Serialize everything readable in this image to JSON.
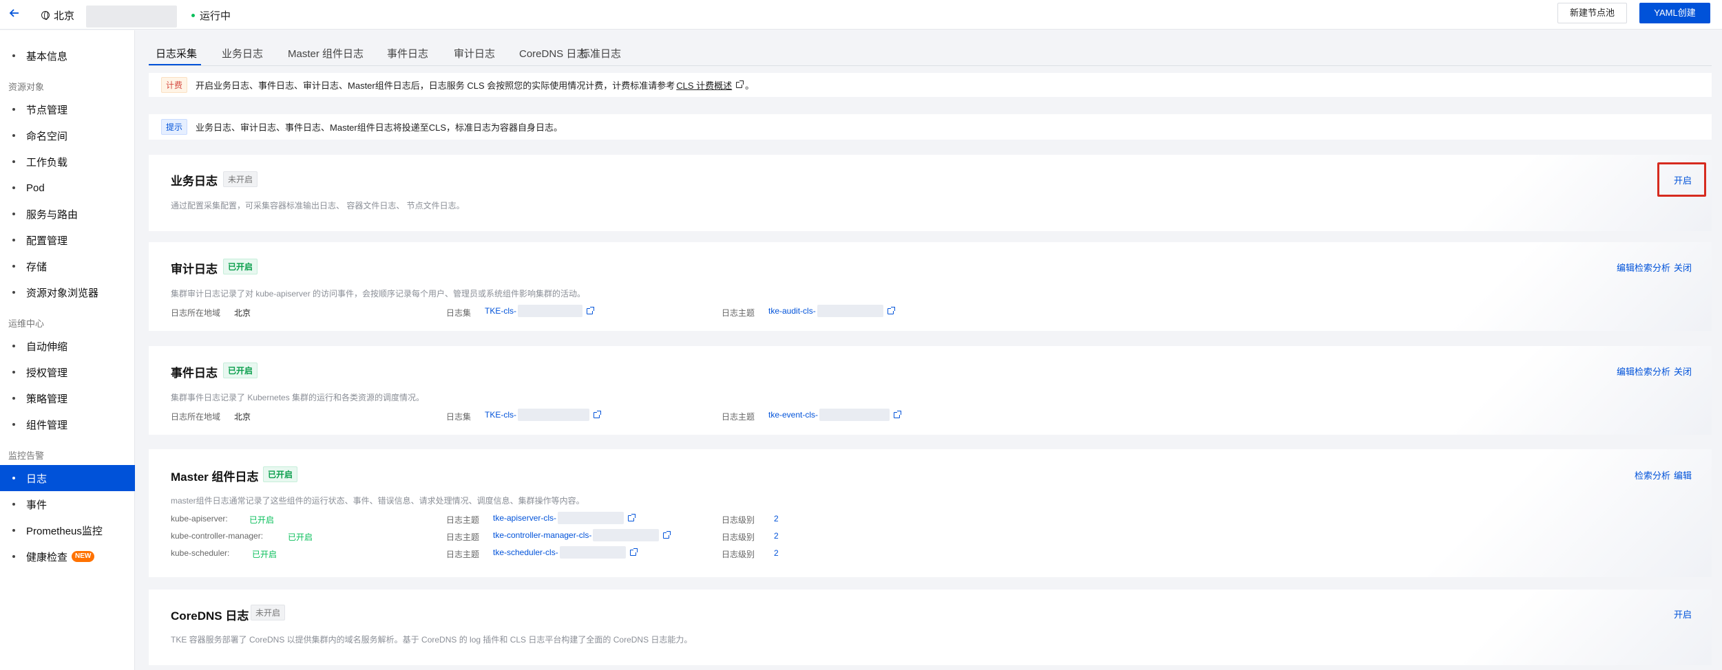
{
  "topbar": {
    "region": "北京",
    "status": "运行中",
    "new_node_pool": "新建节点池",
    "yaml_create": "YAML创建"
  },
  "sidebar": {
    "items": [
      {
        "label": "基本信息"
      },
      {
        "group": "资源对象"
      },
      {
        "label": "节点管理"
      },
      {
        "label": "命名空间"
      },
      {
        "label": "工作负载"
      },
      {
        "label": "Pod"
      },
      {
        "label": "服务与路由"
      },
      {
        "label": "配置管理"
      },
      {
        "label": "存储"
      },
      {
        "label": "资源对象浏览器"
      },
      {
        "group": "运维中心"
      },
      {
        "label": "自动伸缩"
      },
      {
        "label": "授权管理"
      },
      {
        "label": "策略管理"
      },
      {
        "label": "组件管理"
      },
      {
        "group": "监控告警"
      },
      {
        "label": "日志",
        "active": true
      },
      {
        "label": "事件"
      },
      {
        "label": "Prometheus监控"
      },
      {
        "label": "健康检查",
        "badge": "NEW"
      }
    ]
  },
  "tabs": [
    "日志采集",
    "业务日志",
    "Master 组件日志",
    "事件日志",
    "审计日志",
    "CoreDNS 日志",
    "标准日志"
  ],
  "billing_notice": {
    "tag": "计费",
    "text": "开启业务日志、事件日志、审计日志、Master组件日志后，日志服务 CLS 会按照您的实际使用情况计费，计费标准请参考",
    "link": "CLS 计费概述",
    "suffix": "。"
  },
  "tip_notice": {
    "tag": "提示",
    "text": "业务日志、审计日志、事件日志、Master组件日志将投递至CLS，标准日志为容器自身日志。"
  },
  "business_log": {
    "title": "业务日志",
    "state": "未开启",
    "desc": "通过配置采集配置，可采集容器标准输出日志、 容器文件日志、 节点文件日志。",
    "enable": "开启"
  },
  "audit_log": {
    "title": "审计日志",
    "state": "已开启",
    "desc": "集群审计日志记录了对 kube-apiserver 的访问事件，会按顺序记录每个用户、管理员或系统组件影响集群的活动。",
    "region_label": "日志所在地域",
    "region_value": "北京",
    "logset_label": "日志集",
    "logset_value": "TKE-cls-",
    "topic_label": "日志主题",
    "topic_value": "tke-audit-cls-",
    "actions": {
      "edit": "编辑",
      "search": "检索分析",
      "close": "关闭"
    }
  },
  "event_log": {
    "title": "事件日志",
    "state": "已开启",
    "desc": "集群事件日志记录了 Kubernetes 集群的运行和各类资源的调度情况。",
    "region_label": "日志所在地域",
    "region_value": "北京",
    "logset_label": "日志集",
    "logset_value": "TKE-cls-",
    "topic_label": "日志主题",
    "topic_value": "tke-event-cls-",
    "actions": {
      "edit": "编辑",
      "search": "检索分析",
      "close": "关闭"
    }
  },
  "master_log": {
    "title": "Master 组件日志",
    "state": "已开启",
    "desc": "master组件日志通常记录了这些组件的运行状态、事件、错误信息、请求处理情况、调度信息、集群操作等内容。",
    "actions": {
      "search": "检索分析",
      "edit": "编辑"
    },
    "rows": [
      {
        "component": "kube-apiserver:",
        "state": "已开启",
        "topic_label": "日志主题",
        "topic": "tke-apiserver-cls-",
        "level_label": "日志级别",
        "level": "2"
      },
      {
        "component": "kube-controller-manager:",
        "state": "已开启",
        "topic_label": "日志主题",
        "topic": "tke-controller-manager-cls-",
        "level_label": "日志级别",
        "level": "2"
      },
      {
        "component": "kube-scheduler:",
        "state": "已开启",
        "topic_label": "日志主题",
        "topic": "tke-scheduler-cls-",
        "level_label": "日志级别",
        "level": "2"
      }
    ]
  },
  "coredns_log": {
    "title": "CoreDNS 日志",
    "state": "未开启",
    "desc": "TKE 容器服务部署了 CoreDNS 以提供集群内的域名服务解析。基于 CoreDNS 的 log 插件和 CLS 日志平台构建了全面的 CoreDNS 日志能力。",
    "enable": "开启"
  },
  "colors": {
    "primary": "#0052d9",
    "success": "#0abf5b",
    "highlight": "#d62b1f",
    "page_bg": "#f3f4f7"
  }
}
